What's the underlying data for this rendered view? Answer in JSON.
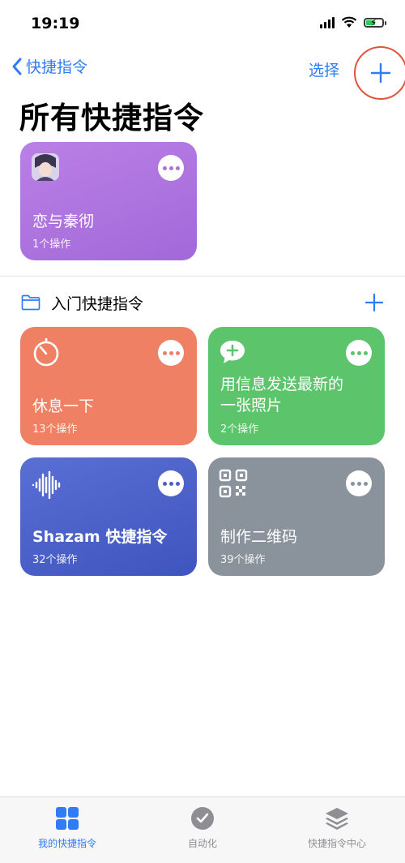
{
  "status": {
    "time": "19:19"
  },
  "nav": {
    "back_label": "快捷指令",
    "select_label": "选择"
  },
  "page": {
    "title": "所有快捷指令"
  },
  "top_card": {
    "title": "恋与秦彻",
    "subtitle": "1个操作",
    "color": "#b070dc"
  },
  "folder": {
    "label": "入门快捷指令"
  },
  "cards": [
    {
      "title": "休息一下",
      "subtitle": "13个操作",
      "color": "#ef8064",
      "icon": "timer-icon"
    },
    {
      "title": "用信息发送最新的\n一张照片",
      "subtitle": "2个操作",
      "color": "#5cc46b",
      "icon": "message-plus-icon"
    },
    {
      "title": "Shazam 快捷指令",
      "subtitle": "32个操作",
      "color": "#4a5fc8",
      "icon": "waveform-icon"
    },
    {
      "title": "制作二维码",
      "subtitle": "39个操作",
      "color": "#8a929c",
      "icon": "qr-code-icon"
    }
  ],
  "tabs": [
    {
      "label": "我的快捷指令",
      "active": true
    },
    {
      "label": "自动化",
      "active": false
    },
    {
      "label": "快捷指令中心",
      "active": false
    }
  ],
  "colors": {
    "accent": "#2f7cf6",
    "highlight_circle": "#e0553d"
  }
}
